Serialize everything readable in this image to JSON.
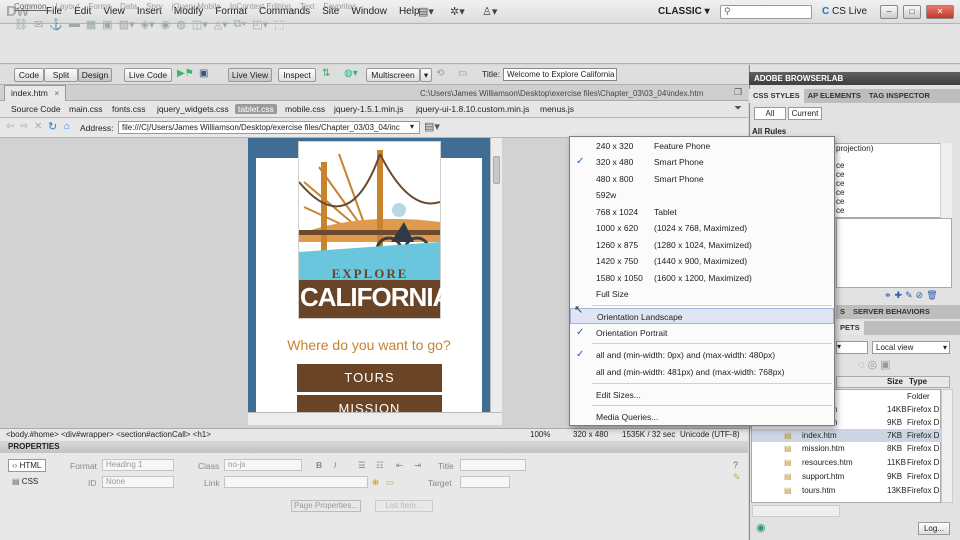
{
  "app": {
    "logo": "Dw",
    "workspace": "CLASSIC",
    "cs_live": "CS Live",
    "search_placeholder": ""
  },
  "menu": [
    "File",
    "Edit",
    "View",
    "Insert",
    "Modify",
    "Format",
    "Commands",
    "Site",
    "Window",
    "Help"
  ],
  "insert_tabs": [
    "Common",
    "Layout",
    "Forms",
    "Data",
    "Spry",
    "jQuery Mobile",
    "InContext Editing",
    "Text",
    "Favorites"
  ],
  "doc_toolbar": {
    "code": "Code",
    "split": "Split",
    "design": "Design",
    "live_code": "Live Code",
    "live_view": "Live View",
    "inspect": "Inspect",
    "multiscreen": "Multiscreen",
    "title_label": "Title:",
    "title_value": "Welcome to Explore California"
  },
  "doc_tab": {
    "name": "index.htm",
    "close": "×",
    "path": "C:\\Users\\James Williamson\\Desktop\\exercise files\\Chapter_03\\03_04\\index.htm"
  },
  "related_files": [
    "Source Code",
    "main.css",
    "fonts.css",
    "jquery_widgets.css",
    "tablet.css",
    "mobile.css",
    "jquery-1.5.1.min.js",
    "jquery-ui-1.8.10.custom.min.js",
    "menus.js"
  ],
  "address": {
    "label": "Address:",
    "value": "file:///C|/Users/James Williamson/Desktop/exercise files/Chapter_03/03_04/inc"
  },
  "page": {
    "explore": "EXPLORE",
    "california": "CALIFORNIA",
    "question": "Where do you want to go?",
    "tours": "TOURS",
    "mission": "MISSION"
  },
  "status": {
    "tag_selector": "<body.#home> <div#wrapper> <section#actionCall> <h1>",
    "zoom": "100%",
    "size": "320 x 480",
    "weight": "1535K / 32 sec",
    "encoding": "Unicode (UTF-8)"
  },
  "properties": {
    "title": "PROPERTIES",
    "html": "HTML",
    "css": "CSS",
    "format_label": "Format",
    "format_value": "Heading 1",
    "class_label": "Class",
    "class_value": "no-js",
    "id_label": "ID",
    "id_value": "None",
    "link_label": "Link",
    "title_label": "Title",
    "target_label": "Target",
    "page_props": "Page Properties...",
    "list_item": "List Item..."
  },
  "right_panel": {
    "browserlab": "ADOBE BROWSERLAB",
    "tabs": [
      "CSS STYLES",
      "AP ELEMENTS",
      "TAG INSPECTOR"
    ],
    "all": "All",
    "current": "Current",
    "all_rules": "All Rules",
    "rule_top": "projection)",
    "rule_items": [
      "ce",
      "ce",
      "ce",
      "ce",
      "ce",
      "ce"
    ],
    "server_tabs": [
      "S",
      "SERVER BEHAVIORS"
    ],
    "pets": "PETS",
    "local_view": "Local view",
    "col_size": "Size",
    "col_type": "Type",
    "files": [
      {
        "name": "",
        "size": "",
        "type": "Folder"
      },
      {
        "name": "htm",
        "size": "14KB",
        "type": "Firefox D"
      },
      {
        "name": "htm",
        "size": "9KB",
        "type": "Firefox D"
      },
      {
        "name": "index.htm",
        "size": "7KB",
        "type": "Firefox D"
      },
      {
        "name": "mission.htm",
        "size": "8KB",
        "type": "Firefox D"
      },
      {
        "name": "resources.htm",
        "size": "11KB",
        "type": "Firefox D"
      },
      {
        "name": "support.htm",
        "size": "9KB",
        "type": "Firefox D"
      },
      {
        "name": "tours.htm",
        "size": "13KB",
        "type": "Firefox D"
      }
    ],
    "log": "Log..."
  },
  "multiscreen_menu": [
    {
      "check": "",
      "label": "240 x  320",
      "desc": "Feature Phone"
    },
    {
      "check": "✓",
      "label": "320 x  480",
      "desc": "Smart Phone"
    },
    {
      "check": "",
      "label": "480 x  800",
      "desc": "Smart Phone"
    },
    {
      "check": "",
      "label": "592w",
      "desc": ""
    },
    {
      "check": "",
      "label": "768 x 1024",
      "desc": "Tablet"
    },
    {
      "check": "",
      "label": "1000 x  620",
      "desc": "(1024 x 768, Maximized)"
    },
    {
      "check": "",
      "label": "1260 x  875",
      "desc": "(1280 x 1024, Maximized)"
    },
    {
      "check": "",
      "label": "1420 x  750",
      "desc": "(1440 x 900, Maximized)"
    },
    {
      "check": "",
      "label": "1580 x 1050",
      "desc": "(1600 x 1200, Maximized)"
    },
    {
      "check": "",
      "label": "Full Size",
      "desc": ""
    },
    {
      "check": "",
      "label": "Orientation Landscape",
      "desc": ""
    },
    {
      "check": "✓",
      "label": "Orientation Portrait",
      "desc": ""
    },
    {
      "check": "✓",
      "label": "all and (min-width: 0px) and (max-width: 480px)",
      "desc": ""
    },
    {
      "check": "",
      "label": "all and (min-width: 481px) and (max-width: 768px)",
      "desc": ""
    },
    {
      "check": "",
      "label": "Edit Sizes...",
      "desc": ""
    },
    {
      "check": "",
      "label": "Media Queries...",
      "desc": ""
    }
  ],
  "colors": {
    "accent_brown": "#6a4426",
    "page_blue": "#3f6d93",
    "question_orange": "#c9822d",
    "sky_blue": "#69c6dc"
  }
}
